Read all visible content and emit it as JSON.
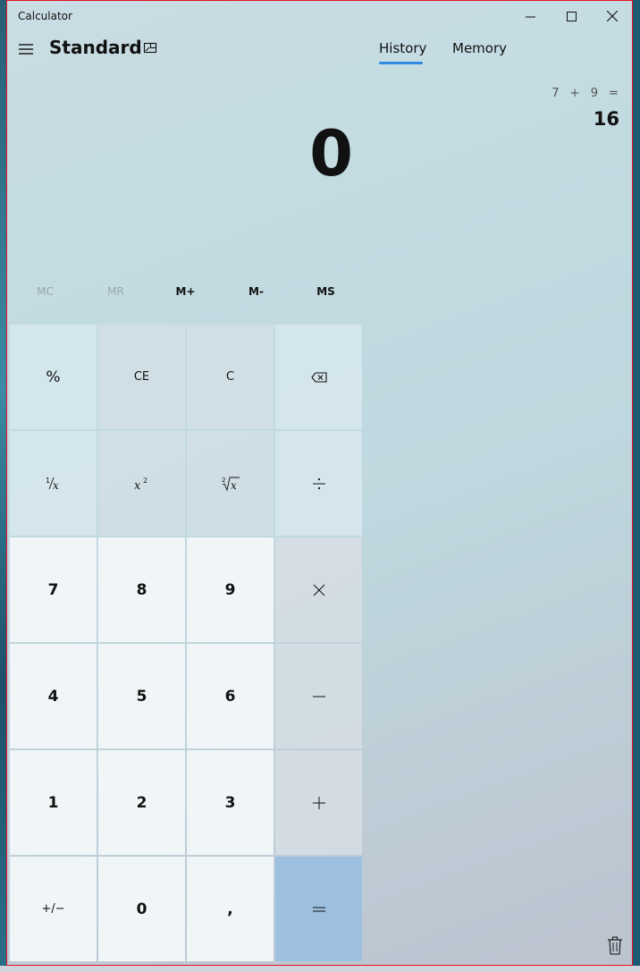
{
  "window": {
    "title": "Calculator"
  },
  "header": {
    "mode": "Standard"
  },
  "tabs": [
    {
      "label": "History",
      "active": true
    },
    {
      "label": "Memory",
      "active": false
    }
  ],
  "display": {
    "value": "0"
  },
  "memory": {
    "buttons": [
      {
        "label": "MC",
        "enabled": false
      },
      {
        "label": "MR",
        "enabled": false
      },
      {
        "label": "M+",
        "enabled": true
      },
      {
        "label": "M-",
        "enabled": true
      },
      {
        "label": "MS",
        "enabled": true
      }
    ]
  },
  "keys": {
    "percent": "%",
    "clear_entry": "CE",
    "clear": "C",
    "seven": "7",
    "eight": "8",
    "nine": "9",
    "four": "4",
    "five": "5",
    "six": "6",
    "one": "1",
    "two": "2",
    "three": "3",
    "negate": "+/−",
    "zero": "0",
    "decimal": ","
  },
  "history": {
    "items": [
      {
        "expression": "7 + 9 =",
        "result": "16"
      }
    ]
  },
  "colors": {
    "accent": "#2f8ce0",
    "equals_key": "#9dbfe0",
    "close_border": "#e81123"
  }
}
